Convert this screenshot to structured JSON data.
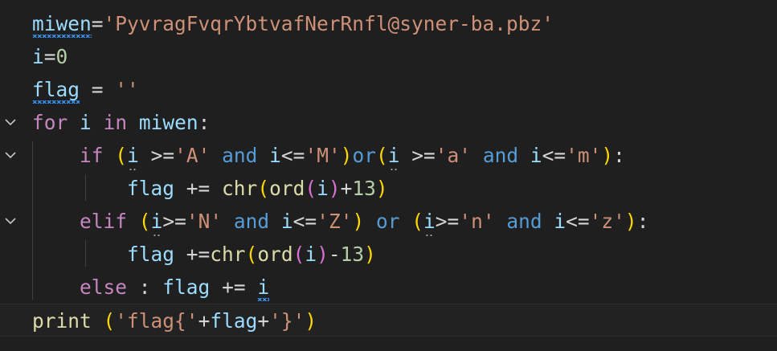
{
  "lines": [
    [
      {
        "t": "miwen",
        "c": "v",
        "deco": "squiggle"
      },
      {
        "t": "=",
        "c": "op"
      },
      {
        "t": "'PyvragFvqrYbtvafNerRnfl@syner-ba.pbz'",
        "c": "s"
      }
    ],
    [
      {
        "t": "i",
        "c": "v"
      },
      {
        "t": "=",
        "c": "op"
      },
      {
        "t": "0",
        "c": "n"
      }
    ],
    [
      {
        "t": "flag",
        "c": "v",
        "deco": "squiggle"
      },
      {
        "t": " = ",
        "c": "op"
      },
      {
        "t": "''",
        "c": "s"
      }
    ],
    [
      {
        "t": "for",
        "c": "k"
      },
      {
        "t": " ",
        "c": "op"
      },
      {
        "t": "i",
        "c": "v"
      },
      {
        "t": " ",
        "c": "op"
      },
      {
        "t": "in",
        "c": "k"
      },
      {
        "t": " ",
        "c": "op"
      },
      {
        "t": "miwen",
        "c": "v"
      },
      {
        "t": ":",
        "c": "op"
      }
    ],
    [
      {
        "t": "    ",
        "c": "op"
      },
      {
        "t": "if",
        "c": "k"
      },
      {
        "t": " ",
        "c": "op"
      },
      {
        "t": "(",
        "c": "b1"
      },
      {
        "t": "i",
        "c": "v",
        "deco": "dots"
      },
      {
        "t": " >=",
        "c": "op"
      },
      {
        "t": "'A'",
        "c": "s"
      },
      {
        "t": " ",
        "c": "op"
      },
      {
        "t": "and",
        "c": "kb"
      },
      {
        "t": " ",
        "c": "op"
      },
      {
        "t": "i",
        "c": "v"
      },
      {
        "t": "<=",
        "c": "op"
      },
      {
        "t": "'M'",
        "c": "s"
      },
      {
        "t": ")",
        "c": "b1"
      },
      {
        "t": "or",
        "c": "kb"
      },
      {
        "t": "(",
        "c": "b1"
      },
      {
        "t": "i",
        "c": "v",
        "deco": "dots"
      },
      {
        "t": " >=",
        "c": "op"
      },
      {
        "t": "'a'",
        "c": "s"
      },
      {
        "t": " ",
        "c": "op"
      },
      {
        "t": "and",
        "c": "kb"
      },
      {
        "t": " ",
        "c": "op"
      },
      {
        "t": "i",
        "c": "v"
      },
      {
        "t": "<=",
        "c": "op"
      },
      {
        "t": "'m'",
        "c": "s"
      },
      {
        "t": ")",
        "c": "b1"
      },
      {
        "t": ":",
        "c": "op"
      }
    ],
    [
      {
        "t": "        ",
        "c": "op"
      },
      {
        "t": "flag",
        "c": "v"
      },
      {
        "t": " += ",
        "c": "op"
      },
      {
        "t": "chr",
        "c": "f"
      },
      {
        "t": "(",
        "c": "b1"
      },
      {
        "t": "ord",
        "c": "f"
      },
      {
        "t": "(",
        "c": "b2"
      },
      {
        "t": "i",
        "c": "v"
      },
      {
        "t": ")",
        "c": "b2"
      },
      {
        "t": "+",
        "c": "op"
      },
      {
        "t": "13",
        "c": "n"
      },
      {
        "t": ")",
        "c": "b1"
      }
    ],
    [
      {
        "t": "    ",
        "c": "op"
      },
      {
        "t": "elif",
        "c": "k"
      },
      {
        "t": " ",
        "c": "op"
      },
      {
        "t": "(",
        "c": "b1"
      },
      {
        "t": "i",
        "c": "v",
        "deco": "dots"
      },
      {
        "t": ">=",
        "c": "op"
      },
      {
        "t": "'N'",
        "c": "s"
      },
      {
        "t": " ",
        "c": "op"
      },
      {
        "t": "and",
        "c": "kb"
      },
      {
        "t": " ",
        "c": "op"
      },
      {
        "t": "i",
        "c": "v"
      },
      {
        "t": "<=",
        "c": "op"
      },
      {
        "t": "'Z'",
        "c": "s"
      },
      {
        "t": ")",
        "c": "b1"
      },
      {
        "t": " ",
        "c": "op"
      },
      {
        "t": "or",
        "c": "kb"
      },
      {
        "t": " ",
        "c": "op"
      },
      {
        "t": "(",
        "c": "b1"
      },
      {
        "t": "i",
        "c": "v",
        "deco": "dots"
      },
      {
        "t": ">=",
        "c": "op"
      },
      {
        "t": "'n'",
        "c": "s"
      },
      {
        "t": " ",
        "c": "op"
      },
      {
        "t": "and",
        "c": "kb"
      },
      {
        "t": " ",
        "c": "op"
      },
      {
        "t": "i",
        "c": "v"
      },
      {
        "t": "<=",
        "c": "op"
      },
      {
        "t": "'z'",
        "c": "s"
      },
      {
        "t": ")",
        "c": "b1"
      },
      {
        "t": ":",
        "c": "op"
      }
    ],
    [
      {
        "t": "        ",
        "c": "op"
      },
      {
        "t": "flag",
        "c": "v"
      },
      {
        "t": " +=",
        "c": "op"
      },
      {
        "t": "chr",
        "c": "f"
      },
      {
        "t": "(",
        "c": "b1"
      },
      {
        "t": "ord",
        "c": "f"
      },
      {
        "t": "(",
        "c": "b2"
      },
      {
        "t": "i",
        "c": "v"
      },
      {
        "t": ")",
        "c": "b2"
      },
      {
        "t": "-",
        "c": "op"
      },
      {
        "t": "13",
        "c": "n"
      },
      {
        "t": ")",
        "c": "b1"
      }
    ],
    [
      {
        "t": "    ",
        "c": "op"
      },
      {
        "t": "else",
        "c": "k"
      },
      {
        "t": " : ",
        "c": "op"
      },
      {
        "t": "flag",
        "c": "v"
      },
      {
        "t": " += ",
        "c": "op"
      },
      {
        "t": "i",
        "c": "v",
        "deco": "squiggle"
      }
    ],
    [
      {
        "t": "print",
        "c": "f"
      },
      {
        "t": " ",
        "c": "op"
      },
      {
        "t": "(",
        "c": "b1"
      },
      {
        "t": "'flag{'",
        "c": "s"
      },
      {
        "t": "+",
        "c": "op"
      },
      {
        "t": "flag",
        "c": "v"
      },
      {
        "t": "+",
        "c": "op"
      },
      {
        "t": "'}'",
        "c": "s"
      },
      {
        "t": ")",
        "c": "b1"
      }
    ]
  ],
  "folds": [
    3,
    4,
    6
  ],
  "current_line": 9,
  "fold_icon": "chevron-down-icon"
}
